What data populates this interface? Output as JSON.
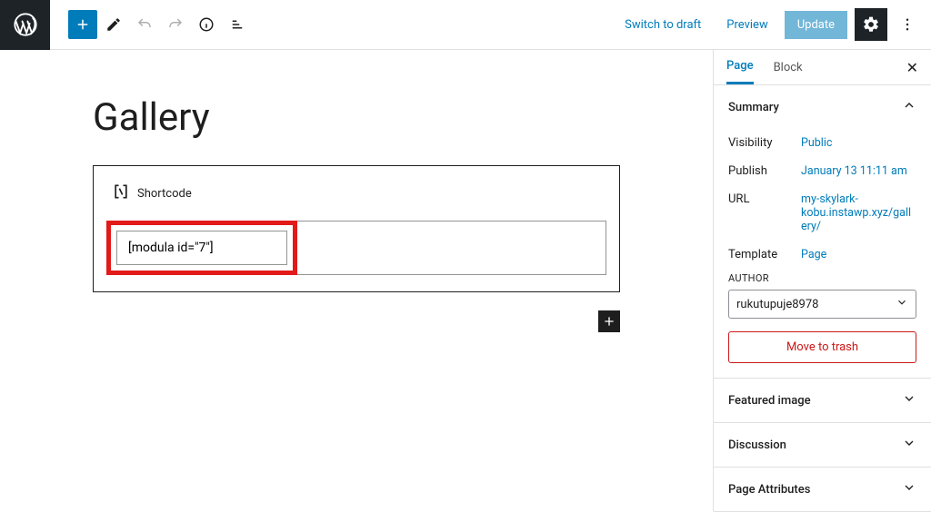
{
  "toolbar": {
    "switch_to_draft": "Switch to draft",
    "preview": "Preview",
    "update": "Update"
  },
  "editor": {
    "title": "Gallery",
    "block": {
      "label": "Shortcode",
      "value": "[modula id=\"7\"]"
    }
  },
  "sidebar": {
    "tabs": {
      "page": "Page",
      "block": "Block"
    },
    "summary": {
      "title": "Summary",
      "visibility": {
        "label": "Visibility",
        "value": "Public"
      },
      "publish": {
        "label": "Publish",
        "value": "January 13 11:11 am"
      },
      "url": {
        "label": "URL",
        "value": "my-skylark-kobu.instawp.xyz/gallery/"
      },
      "template": {
        "label": "Template",
        "value": "Page"
      },
      "author": {
        "label": "AUTHOR",
        "value": "rukutupuje8978"
      },
      "trash": "Move to trash"
    },
    "panels": {
      "featured_image": "Featured image",
      "discussion": "Discussion",
      "page_attributes": "Page Attributes"
    }
  }
}
